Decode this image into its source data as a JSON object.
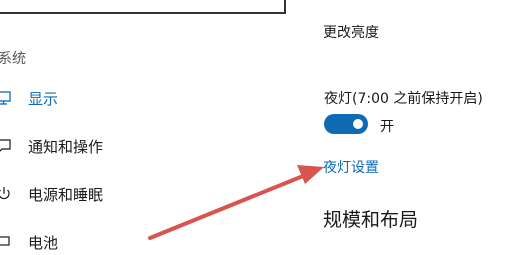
{
  "sidebar": {
    "heading": "系统",
    "items": [
      {
        "label": "显示",
        "icon": "monitor-icon",
        "active": true
      },
      {
        "label": "通知和操作",
        "icon": "notification-icon",
        "active": false
      },
      {
        "label": "电源和睡眠",
        "icon": "power-icon",
        "active": false
      },
      {
        "label": "电池",
        "icon": "battery-icon",
        "active": false
      }
    ]
  },
  "main": {
    "brightness_label": "更改亮度",
    "night_light_label": "夜灯(7:00 之前保持开启)",
    "toggle_state_label": "开",
    "toggle_on": true,
    "night_light_settings_link": "夜灯设置",
    "layout_heading": "规模和布局"
  },
  "colors": {
    "accent": "#0f6ab4",
    "arrow": "#d9534f"
  }
}
